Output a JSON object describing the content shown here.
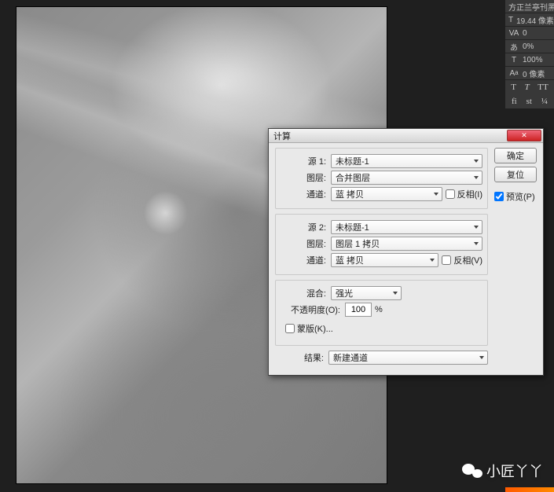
{
  "options_panel": {
    "font_family": "方正兰亭刊黑...",
    "font_size": "19.44 像素",
    "va": "0",
    "aa_percent": "0%",
    "percent_100": "100%",
    "baseline": "0 像素"
  },
  "type_buttons": {
    "bold": "T",
    "italic": "T",
    "allcaps": "TT",
    "fi": "fi",
    "st": "st",
    "frac": "¼"
  },
  "dialog": {
    "title": "计算",
    "source1": {
      "label": "源 1:",
      "value": "未标题-1",
      "layer_label": "图层:",
      "layer_value": "合并图层",
      "channel_label": "通道:",
      "channel_value": "蓝 拷贝",
      "invert_label": "反相(I)"
    },
    "source2": {
      "label": "源 2:",
      "value": "未标题-1",
      "layer_label": "图层:",
      "layer_value": "图层 1 拷贝",
      "channel_label": "通道:",
      "channel_value": "蓝 拷贝",
      "invert_label": "反相(V)"
    },
    "blending": {
      "label": "混合:",
      "value": "强光",
      "opacity_label": "不透明度(O):",
      "opacity_value": "100",
      "opacity_pct": "%",
      "mask_label": "蒙版(K)..."
    },
    "result": {
      "label": "结果:",
      "value": "新建通道"
    },
    "buttons": {
      "ok": "确定",
      "cancel": "复位",
      "preview": "预览(P)"
    }
  },
  "watermark": "小匠丫丫"
}
